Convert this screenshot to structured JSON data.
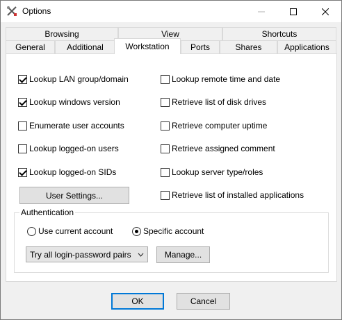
{
  "window": {
    "title": "Options"
  },
  "tabs": {
    "row1": [
      {
        "label": "Browsing"
      },
      {
        "label": "View"
      },
      {
        "label": "Shortcuts"
      }
    ],
    "row2": [
      {
        "label": "General"
      },
      {
        "label": "Additional"
      },
      {
        "label": "Workstation",
        "active": true
      },
      {
        "label": "Ports"
      },
      {
        "label": "Shares"
      },
      {
        "label": "Applications"
      }
    ]
  },
  "left_options": [
    {
      "label": "Lookup LAN group/domain",
      "checked": true
    },
    {
      "label": "Lookup windows version",
      "checked": true
    },
    {
      "label": "Enumerate user accounts",
      "checked": false
    },
    {
      "label": "Lookup logged-on users",
      "checked": false
    },
    {
      "label": "Lookup logged-on SIDs",
      "checked": true
    }
  ],
  "right_options": [
    {
      "label": "Lookup remote time and date",
      "checked": false
    },
    {
      "label": "Retrieve list of disk drives",
      "checked": false
    },
    {
      "label": "Retrieve computer uptime",
      "checked": false
    },
    {
      "label": "Retrieve assigned comment",
      "checked": false
    },
    {
      "label": "Lookup server type/roles",
      "checked": false
    },
    {
      "label": "Retrieve list of installed applications",
      "checked": false
    }
  ],
  "user_settings_label": "User Settings...",
  "authentication": {
    "group_label": "Authentication",
    "radio_current": "Use current account",
    "radio_specific": "Specific account",
    "selected": "specific",
    "dropdown_value": "Try all login-password pairs",
    "manage_label": "Manage..."
  },
  "footer": {
    "ok_label": "OK",
    "cancel_label": "Cancel"
  }
}
